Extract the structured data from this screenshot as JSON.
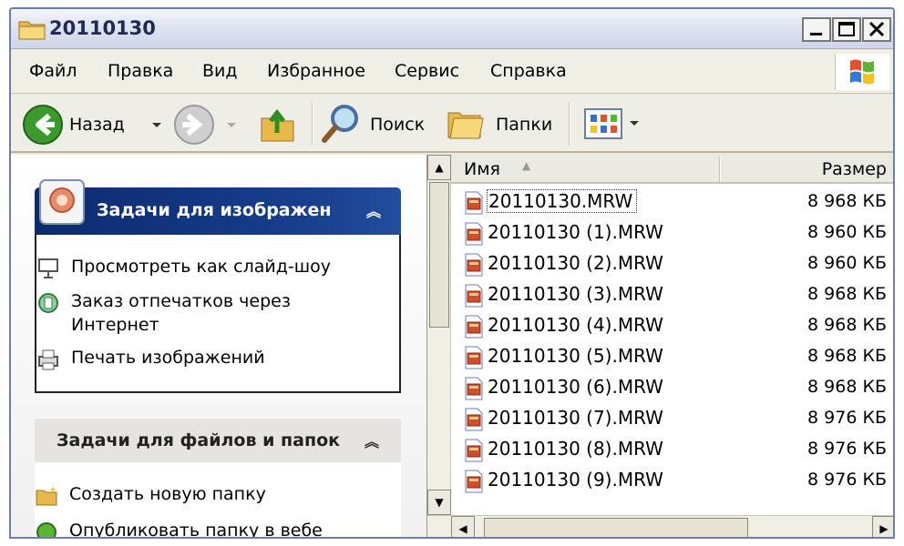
{
  "window": {
    "title": "20110130"
  },
  "menu": [
    "Файл",
    "Правка",
    "Вид",
    "Избранное",
    "Сервис",
    "Справка"
  ],
  "toolbar": {
    "back": "Назад",
    "search": "Поиск",
    "folders": "Папки"
  },
  "task_pane": {
    "image_tasks": {
      "title": "Задачи для изображен",
      "items": [
        "Просмотреть как слайд-шоу",
        "Заказ отпечатков через Интернет",
        "Печать изображений"
      ]
    },
    "file_tasks": {
      "title": "Задачи для файлов и папок",
      "items": [
        "Создать новую папку",
        "Опубликовать папку в вебе"
      ]
    }
  },
  "file_list": {
    "columns": {
      "name": "Имя",
      "size": "Размер"
    },
    "files": [
      {
        "name": "20110130.MRW",
        "size": "8 968 КБ"
      },
      {
        "name": "20110130 (1).MRW",
        "size": "8 960 КБ"
      },
      {
        "name": "20110130 (2).MRW",
        "size": "8 960 КБ"
      },
      {
        "name": "20110130 (3).MRW",
        "size": "8 968 КБ"
      },
      {
        "name": "20110130 (4).MRW",
        "size": "8 968 КБ"
      },
      {
        "name": "20110130 (5).MRW",
        "size": "8 968 КБ"
      },
      {
        "name": "20110130 (6).MRW",
        "size": "8 968 КБ"
      },
      {
        "name": "20110130 (7).MRW",
        "size": "8 976 КБ"
      },
      {
        "name": "20110130 (8).MRW",
        "size": "8 976 КБ"
      },
      {
        "name": "20110130 (9).MRW",
        "size": "8 976 КБ"
      }
    ]
  }
}
